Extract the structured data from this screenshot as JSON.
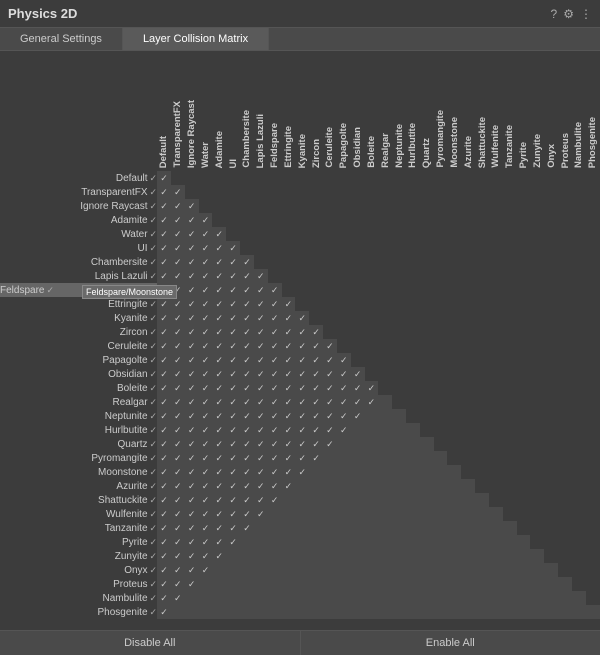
{
  "title": "Physics 2D",
  "tabs": [
    {
      "label": "General Settings",
      "active": false
    },
    {
      "label": "Layer Collision Matrix",
      "active": true
    }
  ],
  "icons": {
    "help": "?",
    "settings": "⚙",
    "menu": "⋮"
  },
  "footer": {
    "disable_all": "Disable All",
    "enable_all": "Enable All"
  },
  "columns": [
    "Default",
    "TransparentFX",
    "Ignore Raycast",
    "Water",
    "Adamite",
    "UI",
    "Chambersite",
    "Lapis Lazuli",
    "Feldspare",
    "Ettringite",
    "Kyanite",
    "Zircon",
    "Ceruleite",
    "Papagolte",
    "Obsidian",
    "Boleite",
    "Realgar",
    "Neptunite",
    "Hurlbutite",
    "Quartz",
    "Pyromangite",
    "Moonstone",
    "Azurite",
    "Shattuckite",
    "Wulfenite",
    "Tanzanite",
    "Pyrite",
    "Zunyite",
    "Onyx",
    "Proteus",
    "Nambulite",
    "Phosgenite"
  ],
  "rows": [
    {
      "label": "Default",
      "checks": [
        1,
        1,
        1,
        1,
        1,
        1,
        1,
        1,
        1,
        1,
        1,
        1,
        1,
        1,
        1,
        1,
        1,
        1,
        1,
        1,
        1,
        1,
        1,
        1,
        1,
        1,
        1,
        1,
        1,
        1,
        1,
        1
      ]
    },
    {
      "label": "TransparentFX",
      "checks": [
        1,
        1,
        1,
        1,
        1,
        1,
        1,
        1,
        1,
        1,
        1,
        1,
        1,
        1,
        1,
        1,
        1,
        1,
        1,
        1,
        1,
        1,
        1,
        1,
        1,
        1,
        1,
        1,
        1,
        1,
        1,
        0
      ]
    },
    {
      "label": "Ignore Raycast",
      "checks": [
        1,
        1,
        1,
        1,
        1,
        1,
        1,
        1,
        1,
        1,
        1,
        1,
        1,
        1,
        1,
        1,
        1,
        1,
        1,
        1,
        1,
        1,
        1,
        1,
        1,
        1,
        1,
        1,
        1,
        1,
        0,
        0
      ]
    },
    {
      "label": "Adamite",
      "checks": [
        1,
        1,
        1,
        1,
        1,
        1,
        1,
        1,
        1,
        1,
        1,
        1,
        1,
        1,
        1,
        1,
        1,
        1,
        1,
        1,
        1,
        1,
        1,
        1,
        1,
        1,
        1,
        1,
        1,
        0,
        0,
        0
      ]
    },
    {
      "label": "Water",
      "checks": [
        1,
        1,
        1,
        1,
        1,
        1,
        1,
        1,
        1,
        1,
        1,
        1,
        1,
        1,
        1,
        1,
        1,
        1,
        1,
        1,
        1,
        1,
        1,
        1,
        1,
        1,
        1,
        1,
        0,
        0,
        0,
        0
      ]
    },
    {
      "label": "UI",
      "checks": [
        1,
        1,
        1,
        1,
        1,
        1,
        1,
        1,
        1,
        1,
        1,
        1,
        1,
        1,
        1,
        1,
        1,
        1,
        1,
        1,
        1,
        1,
        1,
        1,
        1,
        1,
        1,
        0,
        0,
        0,
        0,
        0
      ]
    },
    {
      "label": "Chambersite",
      "checks": [
        1,
        1,
        1,
        1,
        1,
        1,
        1,
        1,
        1,
        1,
        1,
        1,
        1,
        1,
        1,
        1,
        1,
        1,
        1,
        1,
        1,
        1,
        1,
        1,
        1,
        1,
        0,
        0,
        0,
        0,
        0,
        0
      ]
    },
    {
      "label": "Lapis Lazuli",
      "checks": [
        1,
        1,
        1,
        1,
        1,
        1,
        1,
        1,
        1,
        1,
        1,
        1,
        1,
        1,
        1,
        1,
        1,
        1,
        1,
        1,
        1,
        1,
        1,
        1,
        1,
        0,
        0,
        0,
        0,
        0,
        0,
        0
      ]
    },
    {
      "label": "Feldspare",
      "checks": [
        1,
        1,
        1,
        1,
        1,
        1,
        1,
        1,
        1,
        1,
        1,
        1,
        1,
        1,
        1,
        1,
        1,
        1,
        1,
        1,
        1,
        1,
        1,
        1,
        0,
        0,
        0,
        0,
        0,
        0,
        0,
        0
      ],
      "highlighted": true,
      "tooltip": "Feldspare/Moonstone"
    },
    {
      "label": "Ettringite",
      "checks": [
        1,
        1,
        1,
        1,
        1,
        1,
        1,
        1,
        1,
        1,
        1,
        1,
        1,
        1,
        1,
        1,
        1,
        1,
        1,
        1,
        1,
        1,
        1,
        0,
        0,
        0,
        0,
        0,
        0,
        0,
        0,
        0
      ]
    },
    {
      "label": "Kyanite",
      "checks": [
        1,
        1,
        1,
        1,
        1,
        1,
        1,
        1,
        1,
        1,
        1,
        1,
        1,
        1,
        1,
        1,
        1,
        1,
        1,
        1,
        1,
        1,
        0,
        0,
        0,
        0,
        0,
        0,
        0,
        0,
        0,
        0
      ]
    },
    {
      "label": "Zircon",
      "checks": [
        1,
        1,
        1,
        1,
        1,
        1,
        1,
        1,
        1,
        1,
        1,
        1,
        1,
        1,
        1,
        1,
        1,
        1,
        1,
        1,
        1,
        0,
        0,
        0,
        0,
        0,
        0,
        0,
        0,
        0,
        0,
        0
      ]
    },
    {
      "label": "Ceruleite",
      "checks": [
        1,
        1,
        1,
        1,
        1,
        1,
        1,
        1,
        1,
        1,
        1,
        1,
        1,
        1,
        1,
        1,
        1,
        1,
        1,
        1,
        0,
        0,
        0,
        0,
        0,
        0,
        0,
        0,
        0,
        0,
        0,
        0
      ]
    },
    {
      "label": "Papagolte",
      "checks": [
        1,
        1,
        1,
        1,
        1,
        1,
        1,
        1,
        1,
        1,
        1,
        1,
        1,
        1,
        1,
        1,
        1,
        1,
        1,
        0,
        0,
        0,
        0,
        0,
        0,
        0,
        0,
        0,
        0,
        0,
        0,
        0
      ]
    },
    {
      "label": "Obsidian",
      "checks": [
        1,
        1,
        1,
        1,
        1,
        1,
        1,
        1,
        1,
        1,
        1,
        1,
        1,
        1,
        1,
        1,
        1,
        1,
        0,
        0,
        0,
        0,
        0,
        0,
        0,
        0,
        0,
        0,
        0,
        0,
        0,
        0
      ]
    },
    {
      "label": "Boleite",
      "checks": [
        1,
        1,
        1,
        1,
        1,
        1,
        1,
        1,
        1,
        1,
        1,
        1,
        1,
        1,
        1,
        1,
        1,
        0,
        0,
        0,
        0,
        0,
        0,
        0,
        0,
        0,
        0,
        0,
        0,
        0,
        0,
        0
      ]
    },
    {
      "label": "Realgar",
      "checks": [
        1,
        1,
        1,
        1,
        1,
        1,
        1,
        1,
        1,
        1,
        1,
        1,
        1,
        1,
        1,
        1,
        0,
        0,
        0,
        0,
        0,
        0,
        0,
        0,
        0,
        0,
        0,
        0,
        0,
        0,
        0,
        0
      ]
    },
    {
      "label": "Neptunite",
      "checks": [
        1,
        1,
        1,
        1,
        1,
        1,
        1,
        1,
        1,
        1,
        1,
        1,
        1,
        1,
        1,
        0,
        0,
        0,
        0,
        0,
        0,
        0,
        0,
        0,
        0,
        0,
        0,
        0,
        0,
        0,
        0,
        0
      ]
    },
    {
      "label": "Hurlbutite",
      "checks": [
        1,
        1,
        1,
        1,
        1,
        1,
        1,
        1,
        1,
        1,
        1,
        1,
        1,
        1,
        0,
        0,
        0,
        0,
        0,
        0,
        0,
        0,
        0,
        0,
        0,
        0,
        0,
        0,
        0,
        0,
        0,
        0
      ]
    },
    {
      "label": "Quartz",
      "checks": [
        1,
        1,
        1,
        1,
        1,
        1,
        1,
        1,
        1,
        1,
        1,
        1,
        1,
        0,
        0,
        0,
        0,
        0,
        0,
        0,
        0,
        0,
        0,
        0,
        0,
        0,
        0,
        0,
        0,
        0,
        0,
        0
      ]
    },
    {
      "label": "Pyromangite",
      "checks": [
        1,
        1,
        1,
        1,
        1,
        1,
        1,
        1,
        1,
        1,
        1,
        1,
        0,
        0,
        0,
        0,
        0,
        0,
        0,
        0,
        0,
        0,
        0,
        0,
        0,
        0,
        0,
        0,
        0,
        0,
        0,
        0
      ]
    },
    {
      "label": "Moonstone",
      "checks": [
        1,
        1,
        1,
        1,
        1,
        1,
        1,
        1,
        1,
        1,
        1,
        0,
        0,
        0,
        0,
        0,
        0,
        0,
        0,
        0,
        0,
        0,
        0,
        0,
        0,
        0,
        0,
        0,
        0,
        0,
        0,
        0
      ]
    },
    {
      "label": "Azurite",
      "checks": [
        1,
        1,
        1,
        1,
        1,
        1,
        1,
        1,
        1,
        1,
        0,
        0,
        0,
        0,
        0,
        0,
        0,
        0,
        0,
        0,
        0,
        0,
        0,
        0,
        0,
        0,
        0,
        0,
        0,
        0,
        0,
        0
      ]
    },
    {
      "label": "Shattuckite",
      "checks": [
        1,
        1,
        1,
        1,
        1,
        1,
        1,
        1,
        1,
        0,
        0,
        0,
        0,
        0,
        0,
        0,
        0,
        0,
        0,
        0,
        0,
        0,
        0,
        0,
        0,
        0,
        0,
        0,
        0,
        0,
        0,
        0
      ]
    },
    {
      "label": "Wulfenite",
      "checks": [
        1,
        1,
        1,
        1,
        1,
        1,
        1,
        1,
        0,
        0,
        0,
        0,
        0,
        0,
        0,
        0,
        0,
        0,
        0,
        0,
        0,
        0,
        0,
        0,
        0,
        0,
        0,
        0,
        0,
        0,
        0,
        0
      ]
    },
    {
      "label": "Tanzanite",
      "checks": [
        1,
        1,
        1,
        1,
        1,
        1,
        1,
        0,
        0,
        0,
        0,
        0,
        0,
        0,
        0,
        0,
        0,
        0,
        0,
        0,
        0,
        0,
        0,
        0,
        0,
        0,
        0,
        0,
        0,
        0,
        0,
        0
      ]
    },
    {
      "label": "Pyrite",
      "checks": [
        1,
        1,
        1,
        1,
        1,
        1,
        0,
        0,
        0,
        0,
        0,
        0,
        0,
        0,
        0,
        0,
        0,
        0,
        0,
        0,
        0,
        0,
        0,
        0,
        0,
        0,
        0,
        0,
        0,
        0,
        0,
        0
      ]
    },
    {
      "label": "Zunyite",
      "checks": [
        1,
        1,
        1,
        1,
        1,
        0,
        0,
        0,
        0,
        0,
        0,
        0,
        0,
        0,
        0,
        0,
        0,
        0,
        0,
        0,
        0,
        0,
        0,
        0,
        0,
        0,
        0,
        0,
        0,
        0,
        0,
        0
      ]
    },
    {
      "label": "Onyx",
      "checks": [
        1,
        1,
        1,
        1,
        0,
        0,
        0,
        0,
        0,
        0,
        0,
        0,
        0,
        0,
        0,
        0,
        0,
        0,
        0,
        0,
        0,
        0,
        0,
        0,
        0,
        0,
        0,
        0,
        0,
        0,
        0,
        0
      ]
    },
    {
      "label": "Proteus",
      "checks": [
        1,
        1,
        1,
        0,
        0,
        0,
        0,
        0,
        0,
        0,
        0,
        0,
        0,
        0,
        0,
        0,
        0,
        0,
        0,
        0,
        0,
        0,
        0,
        0,
        0,
        0,
        0,
        0,
        0,
        0,
        0,
        0
      ]
    },
    {
      "label": "Nambulite",
      "checks": [
        1,
        1,
        0,
        0,
        0,
        0,
        0,
        0,
        0,
        0,
        0,
        0,
        0,
        0,
        0,
        0,
        0,
        0,
        0,
        0,
        0,
        0,
        0,
        0,
        0,
        0,
        0,
        0,
        0,
        0,
        0,
        0
      ]
    },
    {
      "label": "Phosgenite",
      "checks": [
        1,
        0,
        0,
        0,
        0,
        0,
        0,
        0,
        0,
        0,
        0,
        0,
        0,
        0,
        0,
        0,
        0,
        0,
        0,
        0,
        0,
        0,
        0,
        0,
        0,
        0,
        0,
        0,
        0,
        0,
        0,
        0
      ]
    }
  ]
}
